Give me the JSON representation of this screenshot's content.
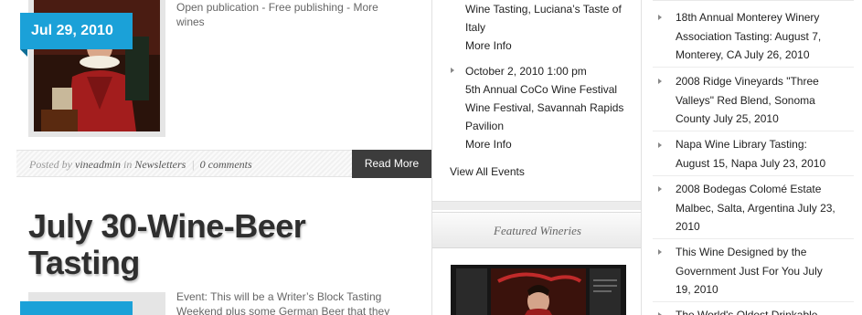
{
  "post1": {
    "date": "Jul 29, 2010",
    "excerpt_line1": "Open publication - Free publishing - More",
    "excerpt_line2": "wines",
    "meta": {
      "posted_by_label": "Posted by",
      "author": "vineadmin",
      "in_label": "in",
      "category": "Newsletters",
      "separator": "|",
      "comments": "0 comments"
    },
    "read_more": "Read More"
  },
  "post2": {
    "title_line1": "July 30-Wine-Beer",
    "title_line2": "Tasting",
    "excerpt_line1": "Event: This will be a Writer’s Block Tasting",
    "excerpt_line2": "Weekend plus some German Beer that they"
  },
  "events": {
    "item1": {
      "line1": "Wine Tasting, Luciana’s Taste of",
      "line2": "Italy",
      "more": "More Info"
    },
    "item2": {
      "date": "October 2, 2010 1:00 pm",
      "line1": "5th Annual CoCo Wine Festival",
      "line2": "Wine Festival, Savannah Rapids",
      "line3": "Pavilion",
      "more": "More Info"
    },
    "view_all": "View All Events"
  },
  "featured": {
    "header": "Featured Wineries"
  },
  "recent": [
    {
      "line1": "18th Annual Monterey Winery",
      "line2": "Association Tasting: August 7,",
      "line3": "Monterey, CA July 26, 2010"
    },
    {
      "line1": "2008 Ridge Vineyards \"Three",
      "line2": "Valleys\" Red Blend, Sonoma",
      "line3": "County July 25, 2010"
    },
    {
      "line1": "Napa Wine Library Tasting:",
      "line2": "August 15, Napa July 23, 2010"
    },
    {
      "line1": "2008 Bodegas Colomé Estate",
      "line2": "Malbec, Salta, Argentina July 23,",
      "line3": "2010"
    },
    {
      "line1": "This Wine Designed by the",
      "line2": "Government Just For You July",
      "line3": "19, 2010"
    },
    {
      "line1": "The World's Oldest Drinkable"
    }
  ],
  "colors": {
    "accent_blue": "#1ba1d8",
    "read_more_bg": "#3c3c3c",
    "title_text": "#2f2f2f"
  }
}
